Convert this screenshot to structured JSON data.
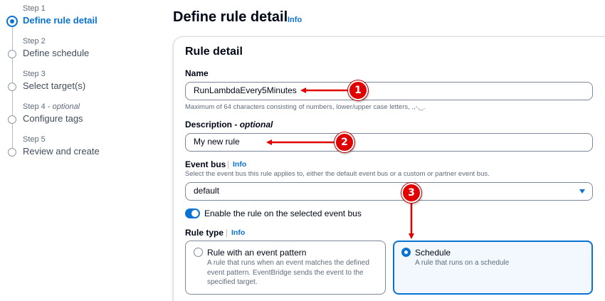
{
  "steps": [
    {
      "num": "Step 1",
      "label": "Define rule detail",
      "active": true
    },
    {
      "num": "Step 2",
      "label": "Define schedule"
    },
    {
      "num": "Step 3",
      "label": "Select target(s)"
    },
    {
      "num": "Step 4",
      "optional": "optional",
      "label": "Configure tags"
    },
    {
      "num": "Step 5",
      "label": "Review and create"
    }
  ],
  "header": {
    "title": "Define rule detail",
    "info": "Info"
  },
  "rule_detail": {
    "title": "Rule detail",
    "name": {
      "label": "Name",
      "value": "RunLambdaEvery5Minutes",
      "constraint": "Maximum of 64 characters consisting of numbers, lower/upper case letters, .,-,_."
    },
    "description": {
      "label": "Description",
      "optional": "optional",
      "value": "My new rule"
    },
    "event_bus": {
      "label": "Event bus",
      "info": "Info",
      "hint": "Select the event bus this rule applies to, either the default event bus or a custom or partner event bus.",
      "value": "default"
    },
    "enable_toggle": {
      "label": "Enable the rule on the selected event bus",
      "checked": true
    },
    "rule_type": {
      "label": "Rule type",
      "info": "Info",
      "options": [
        {
          "title": "Rule with an event pattern",
          "desc_lines": [
            "A rule that runs when an event matches the defined",
            "event pattern. EventBridge sends the event to the",
            "specified target."
          ],
          "selected": false
        },
        {
          "title": "Schedule",
          "desc_lines": [
            "A rule that runs on a schedule"
          ],
          "selected": true
        }
      ]
    }
  },
  "annotations": [
    "1",
    "2",
    "3"
  ],
  "colors": {
    "accent": "#0972d3",
    "annotation": "#e10000",
    "selected_tile_bg": "#f2f8fd"
  }
}
